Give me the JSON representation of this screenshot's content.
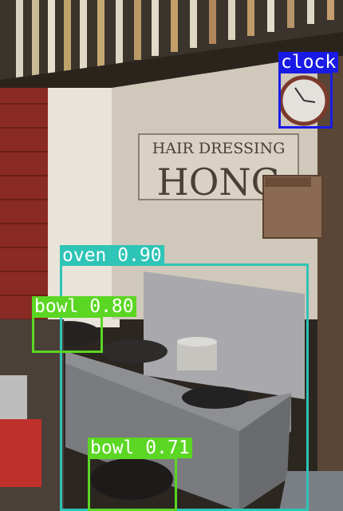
{
  "scene": {
    "sign_top": "HAIR DRESSING",
    "sign_main": "HONG"
  },
  "detections": [
    {
      "label": "clock",
      "text": "clock",
      "color": "#1a1ae6"
    },
    {
      "label": "oven",
      "text": "oven 0.90",
      "color": "#2ec4b6"
    },
    {
      "label": "bowl",
      "text": "bowl 0.80",
      "color": "#5bd623"
    },
    {
      "label": "bowl",
      "text": "bowl 0.71",
      "color": "#5bd623"
    }
  ]
}
